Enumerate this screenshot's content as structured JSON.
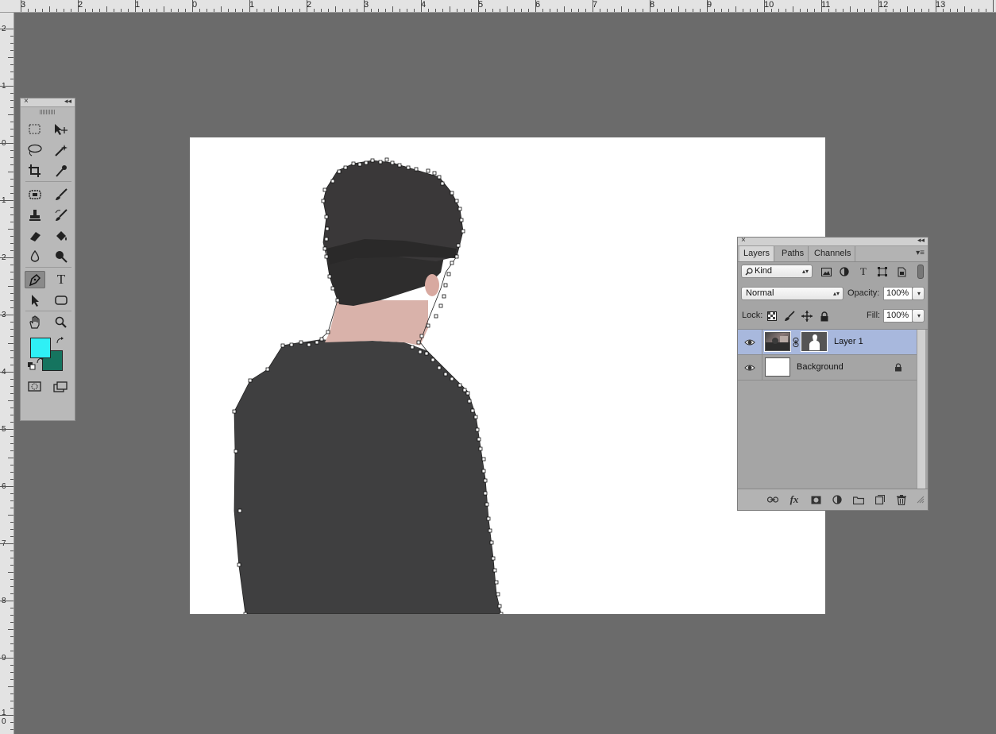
{
  "ruler": {
    "top_labels": [
      "3",
      "2",
      "1",
      "0",
      "1",
      "2",
      "3",
      "4",
      "5",
      "6",
      "7",
      "8",
      "9",
      "10",
      "11",
      "12",
      "13"
    ],
    "left_labels": [
      "2",
      "1",
      "0",
      "1",
      "2",
      "3",
      "4",
      "5",
      "6",
      "7",
      "8",
      "9",
      "1\n0"
    ]
  },
  "tools_panel": {
    "close_glyph": "×",
    "collapse_glyph": "◂◂",
    "tools": [
      {
        "name": "rectangular-marquee-icon"
      },
      {
        "name": "move-tool-icon"
      },
      {
        "name": "lasso-icon"
      },
      {
        "name": "magic-wand-icon"
      },
      {
        "name": "crop-icon"
      },
      {
        "name": "eyedropper-icon"
      },
      {
        "name": "spot-healing-icon"
      },
      {
        "name": "brush-icon"
      },
      {
        "name": "clone-stamp-icon"
      },
      {
        "name": "history-brush-icon"
      },
      {
        "name": "eraser-icon"
      },
      {
        "name": "paint-bucket-icon"
      },
      {
        "name": "blur-icon"
      },
      {
        "name": "dodge-icon"
      },
      {
        "name": "pen-tool-icon"
      },
      {
        "name": "type-tool-icon"
      },
      {
        "name": "path-selection-icon"
      },
      {
        "name": "shape-tool-icon"
      },
      {
        "name": "hand-tool-icon"
      },
      {
        "name": "zoom-tool-icon"
      }
    ],
    "type_tool_glyph": "T",
    "foreground_color": "#2ff0f5",
    "background_color": "#15745f"
  },
  "layers_panel": {
    "close_glyph": "×",
    "collapse_glyph": "◂◂",
    "tabs": [
      {
        "label": "Layers"
      },
      {
        "label": "Paths"
      },
      {
        "label": "Channels"
      }
    ],
    "menu_glyph": "▾≡",
    "filter_kind": "Kind",
    "blend_mode": "Normal",
    "opacity_label": "Opacity:",
    "opacity_value": "100%",
    "lock_label": "Lock:",
    "fill_label": "Fill:",
    "fill_value": "100%",
    "layers": [
      {
        "name": "Layer 1",
        "selected": true
      },
      {
        "name": "Background",
        "selected": false
      }
    ],
    "fx_label": "fx"
  }
}
